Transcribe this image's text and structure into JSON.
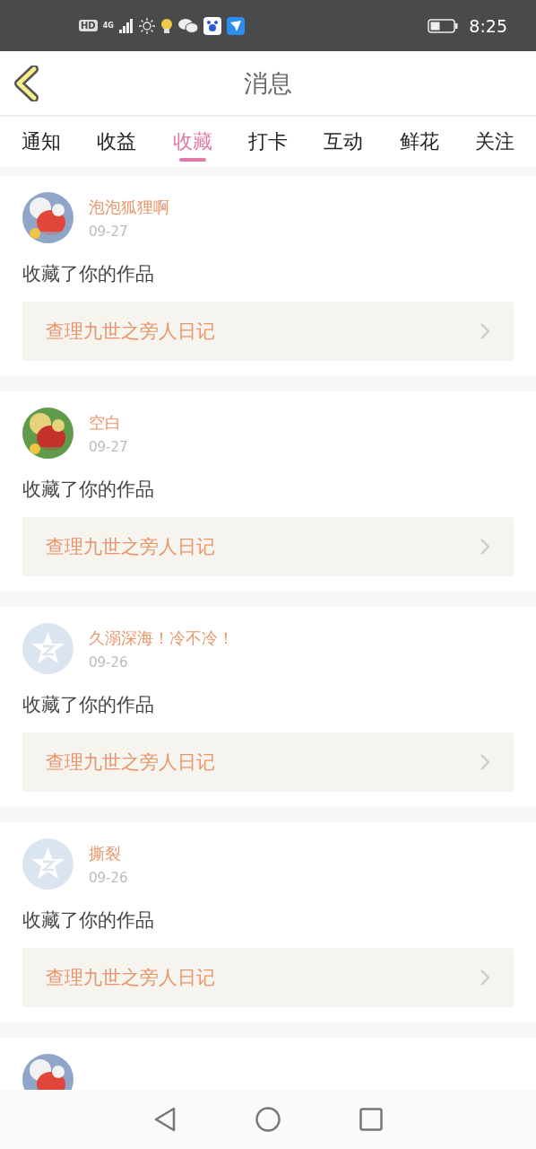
{
  "status_bar": {
    "time": "8:25",
    "hd": "HD",
    "network": "4G"
  },
  "header": {
    "title": "消息"
  },
  "tabs": [
    {
      "label": "通知",
      "selected": false
    },
    {
      "label": "收益",
      "selected": false
    },
    {
      "label": "收藏",
      "selected": true
    },
    {
      "label": "打卡",
      "selected": false
    },
    {
      "label": "互动",
      "selected": false
    },
    {
      "label": "鲜花",
      "selected": false
    },
    {
      "label": "关注",
      "selected": false
    }
  ],
  "messages": [
    {
      "avatar": {
        "kind": "picture"
      },
      "name": "泡泡狐狸啊",
      "date": "09-27",
      "action": "收藏了你的作品",
      "work": "查理九世之旁人日记"
    },
    {
      "avatar": {
        "kind": "picture"
      },
      "name": "空白",
      "date": "09-27",
      "action": "收藏了你的作品",
      "work": "查理九世之旁人日记"
    },
    {
      "avatar": {
        "kind": "default"
      },
      "name": "久溺深海！冷不冷！",
      "date": "09-26",
      "action": "收藏了你的作品",
      "work": "查理九世之旁人日记"
    },
    {
      "avatar": {
        "kind": "default"
      },
      "name": "撕裂",
      "date": "09-26",
      "action": "收藏了你的作品",
      "work": "查理九世之旁人日记"
    },
    {
      "avatar": {
        "kind": "picture"
      }
    }
  ]
}
